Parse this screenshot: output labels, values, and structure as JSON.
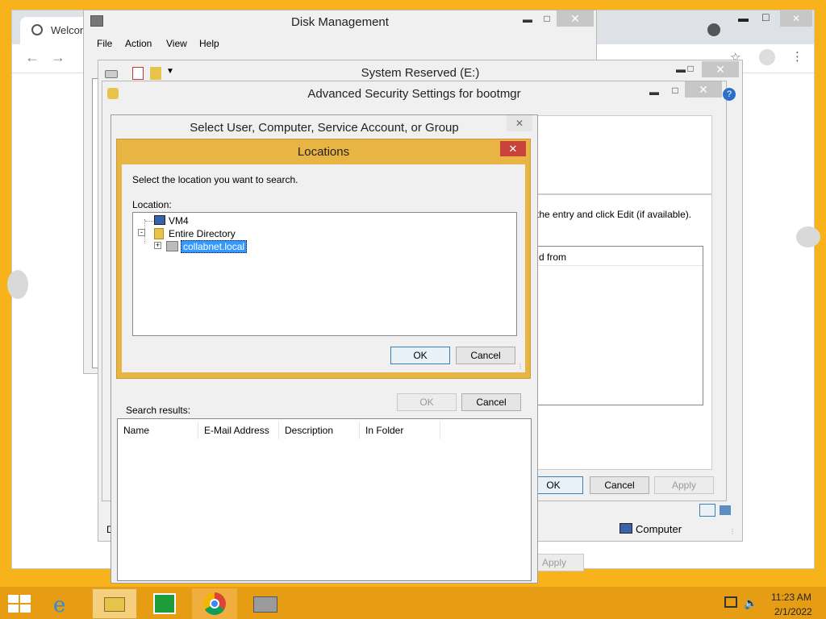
{
  "chrome": {
    "tab_title": "Welcom",
    "bg_color": "#ffffff"
  },
  "disk_mgmt": {
    "title": "Disk Management",
    "menu": [
      "File",
      "Action",
      "View",
      "Help"
    ],
    "bottom_label": "D",
    "apply_label": "Apply"
  },
  "sys_reserved": {
    "title": "System Reserved (E:)",
    "computer_label": "Computer"
  },
  "adv_security": {
    "title": "Advanced Security Settings for bootmgr",
    "hint_text": "the entry and click Edit (if available).",
    "col_inherited": "d from",
    "ok_label": "OK",
    "cancel_label": "Cancel",
    "apply_label": "Apply"
  },
  "select_user": {
    "title": "Select User, Computer, Service Account, or Group",
    "ok_label": "OK",
    "cancel_label": "Cancel",
    "search_results_label": "Search results:",
    "columns": [
      "Name",
      "E-Mail Address",
      "Description",
      "In Folder"
    ]
  },
  "locations": {
    "title": "Locations",
    "prompt": "Select the location you want to search.",
    "location_label": "Location:",
    "tree": [
      {
        "label": "VM4"
      },
      {
        "label": "Entire Directory"
      },
      {
        "label": "collabnet.local"
      }
    ],
    "ok_label": "OK",
    "cancel_label": "Cancel"
  },
  "taskbar": {
    "time": "11:23 AM",
    "date": "2/1/2022"
  },
  "colors": {
    "accent_orange": "#f7b21c",
    "dialog_border": "#e8b443",
    "close_red": "#c9423a",
    "selection_blue": "#3399ff"
  }
}
